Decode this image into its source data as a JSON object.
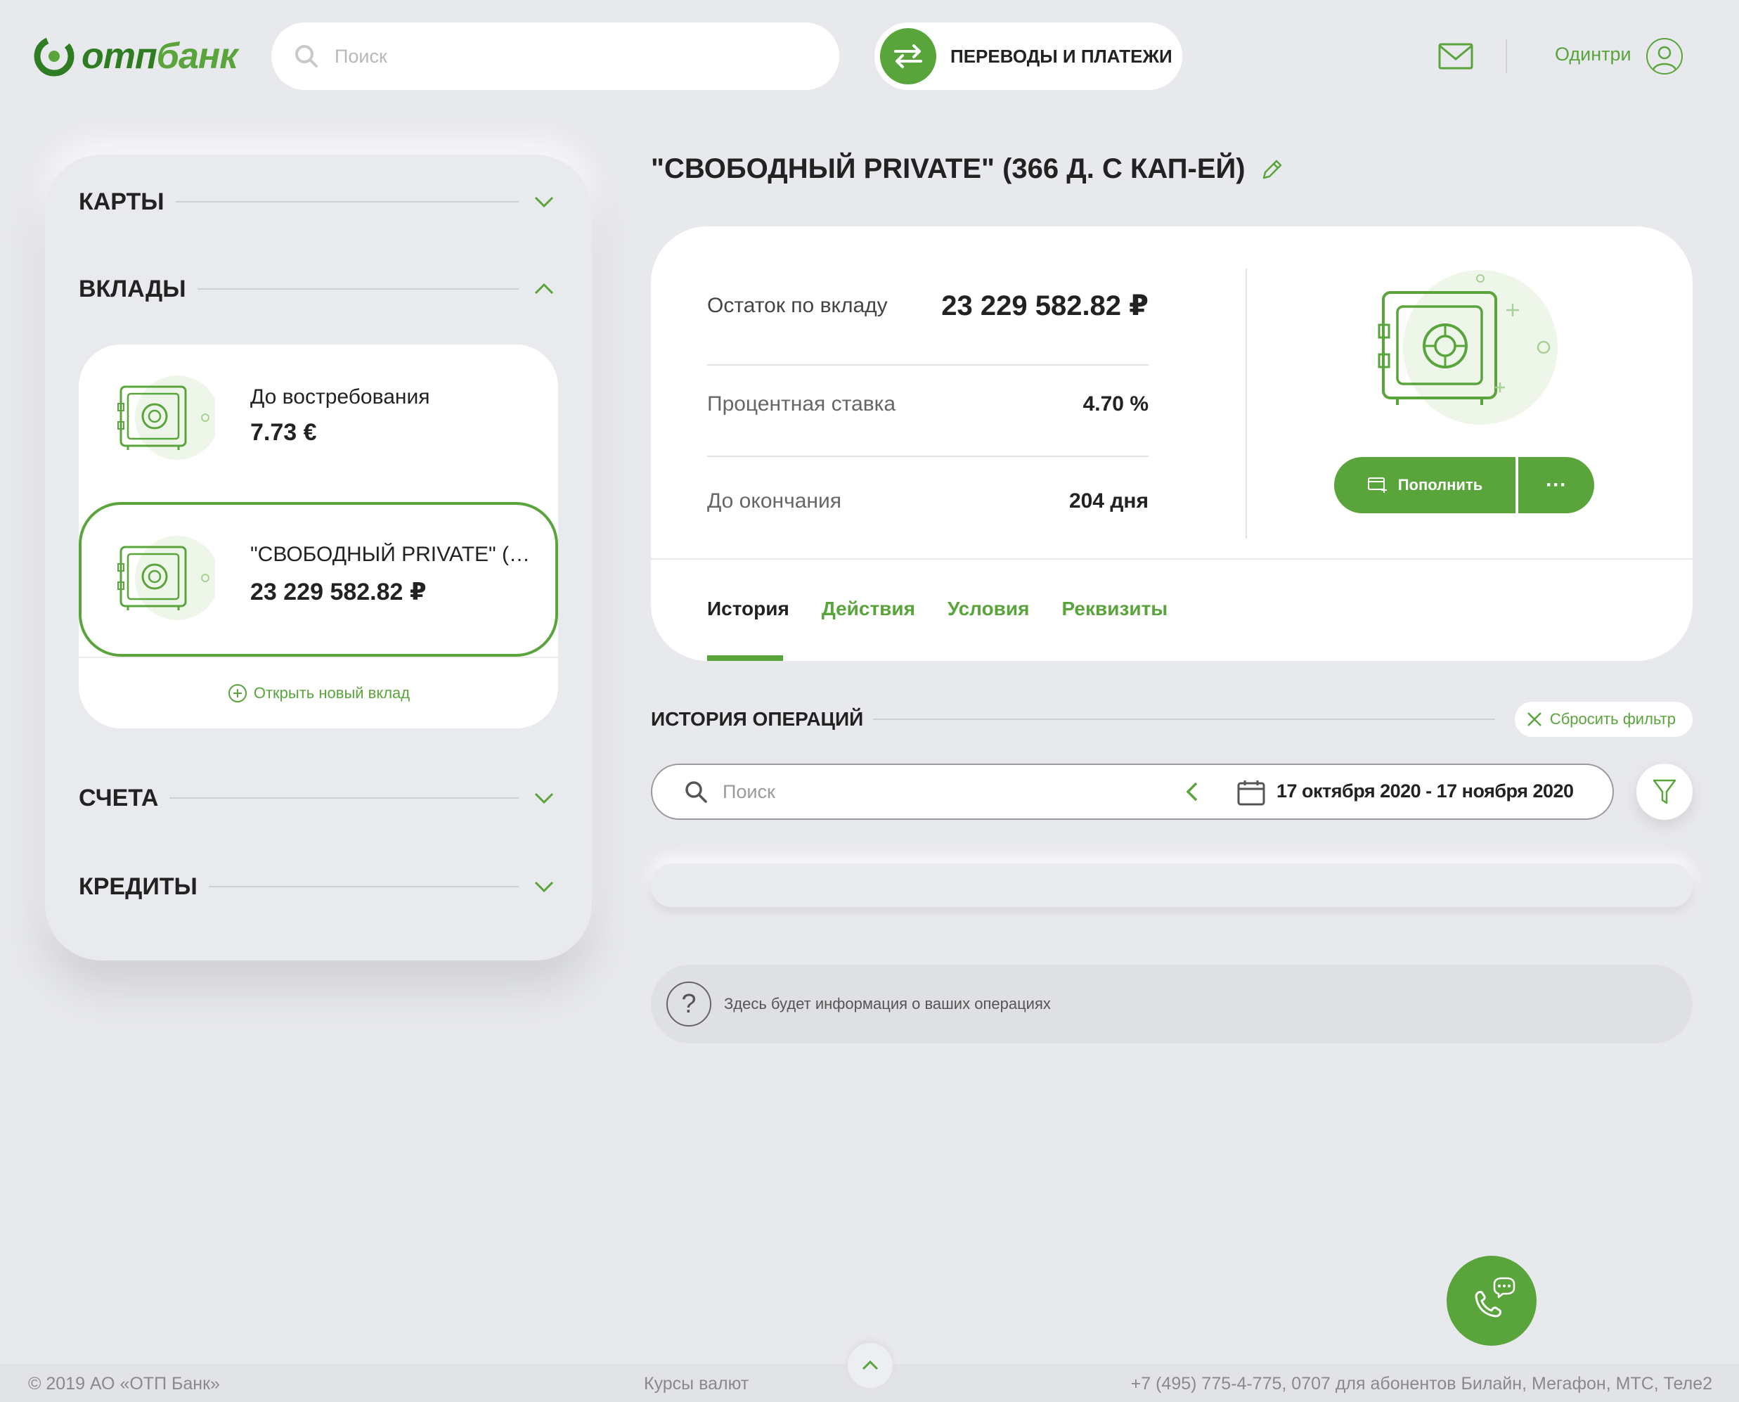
{
  "brand": {
    "logo_text_bold": "отп",
    "logo_text_light": "банк",
    "accent_color": "#5aa43c"
  },
  "header": {
    "search_placeholder": "Поиск",
    "transfers_label": "ПЕРЕВОДЫ И ПЛАТЕЖИ",
    "user_name": "Одинтри",
    "icons": [
      "search-icon",
      "transfer-icon",
      "mail-icon",
      "user-avatar-icon"
    ]
  },
  "sidebar": {
    "sections": [
      {
        "title": "КАРТЫ",
        "expanded": false
      },
      {
        "title": "ВКЛАДЫ",
        "expanded": true
      },
      {
        "title": "СЧЕТА",
        "expanded": false
      },
      {
        "title": "КРЕДИТЫ",
        "expanded": false
      }
    ],
    "deposits": [
      {
        "name": "До востребования",
        "amount": "7.73 €",
        "selected": false
      },
      {
        "name": "\"СВОБОДНЫЙ PRIVATE\" (366 Д. С КАП-ЕЙ)",
        "amount": "23 229 582.82 ₽",
        "selected": true
      }
    ],
    "open_deposit_label": "Открыть новый вклад"
  },
  "main": {
    "title": "\"СВОБОДНЫЙ PRIVATE\" (366 Д. С КАП-ЕЙ)",
    "details": {
      "balance_label": "Остаток по вкладу",
      "balance_value": "23 229 582.82 ₽",
      "rate_label": "Процентная ставка",
      "rate_value": "4.70 %",
      "term_label": "До окончания",
      "term_value": "204 дня"
    },
    "actions": {
      "topup_label": "Пополнить",
      "more_label": "···"
    },
    "tabs": [
      {
        "label": "История",
        "active": true
      },
      {
        "label": "Действия",
        "active": false
      },
      {
        "label": "Условия",
        "active": false
      },
      {
        "label": "Реквизиты",
        "active": false
      }
    ],
    "history": {
      "title": "ИСТОРИЯ ОПЕРАЦИЙ",
      "reset_filter_label": "Сбросить фильтр",
      "search_placeholder": "Поиск",
      "date_range": "17 октября 2020 - 17 ноября 2020",
      "empty_info": "Здесь будет информация о ваших операциях",
      "help_symbol": "?"
    }
  },
  "footer": {
    "copyright": "© 2019 АО «ОТП Банк»",
    "rates_link": "Курсы валют",
    "phone": "+7 (495) 775-4-775,  0707 для абонентов Билайн, Мегафон, МТС, Теле2"
  }
}
